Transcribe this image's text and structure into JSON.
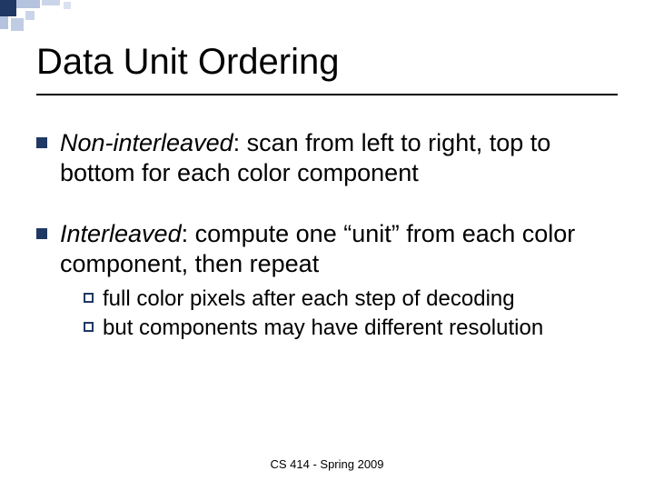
{
  "title": "Data Unit Ordering",
  "bullets": [
    {
      "lead": "Non-interleaved",
      "rest": ": scan from left to right, top to bottom for each color component",
      "sub": []
    },
    {
      "lead": "Interleaved",
      "rest": ": compute one “unit” from each color component, then repeat",
      "sub": [
        {
          "text": "full color pixels after each step of decoding"
        },
        {
          "text": "but components may have different resolution"
        }
      ]
    }
  ],
  "footer": "CS 414 - Spring 2009"
}
